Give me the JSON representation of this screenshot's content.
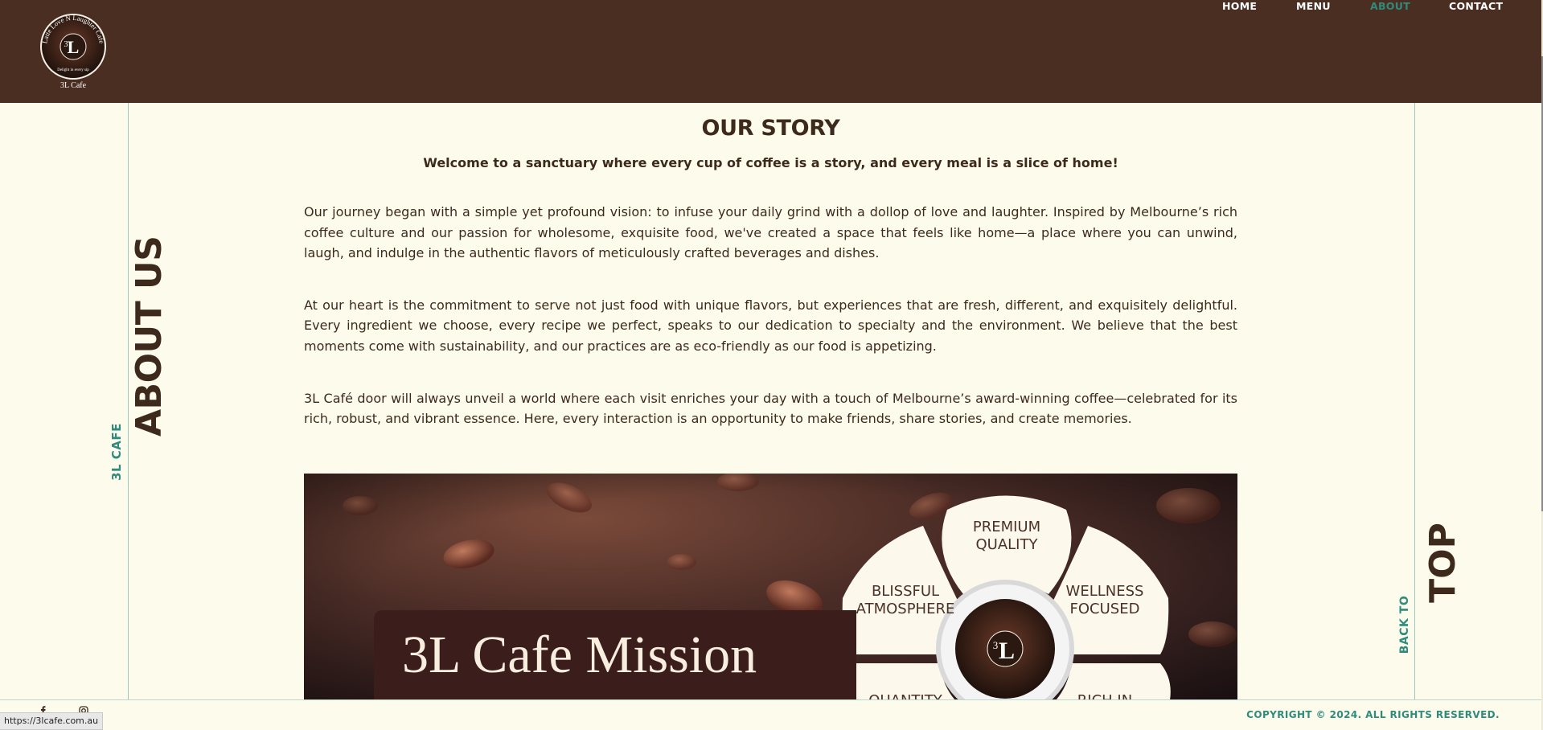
{
  "header": {
    "logo_text": "3L Cafe",
    "logo_ring_text": "Latte Love N Laughter Cafe",
    "logo_tagline": "Delight in every sip",
    "nav": [
      {
        "label": "HOME"
      },
      {
        "label": "MENU"
      },
      {
        "label": "ABOUT",
        "active": true
      },
      {
        "label": "CONTACT"
      }
    ]
  },
  "side": {
    "section_label": "ABOUT US",
    "brand_label": "3L CAFE",
    "back_top": "TOP",
    "back_to": "BACK TO"
  },
  "main": {
    "title": "OUR STORY",
    "welcome": "Welcome to a sanctuary where every cup of coffee is a story, and every meal is a slice of home!",
    "paragraphs": [
      "Our journey began with a simple yet profound vision: to infuse your daily grind with a dollop of love and laughter. Inspired by Melbourne’s rich coffee culture and our passion for wholesome, exquisite food, we've created a space that feels like home—a place where you can unwind, laugh, and indulge in the authentic flavors of meticulously crafted beverages and dishes.",
      "At our heart is the commitment to serve not just food with unique flavors, but experiences that are fresh, different, and exquisitely delightful. Every ingredient we choose, every recipe we perfect, speaks to our dedication to specialty and the environment. We believe that the best moments come with sustainability, and our practices are as eco-friendly as our food is appetizing.",
      "3L Café door will always unveil a world where each visit enriches your day with a touch of Melbourne’s award-winning coffee—celebrated for its rich, robust, and vibrant essence. Here, every interaction is an opportunity to make friends, share stories, and create memories."
    ],
    "mission": {
      "title": "3L Cafe Mission",
      "petals": [
        "PREMIUM\nQUALITY",
        "BLISSFUL\nATMOSPHERE",
        "WELLNESS\nFOCUSED",
        "QUANTITY",
        "RICH IN"
      ]
    }
  },
  "footer": {
    "copyright": "COPYRIGHT © 2024. ALL RIGHTS RESERVED."
  },
  "status_bar": {
    "url": "https://3lcafe.com.au"
  },
  "colors": {
    "header_bg": "#4b2e22",
    "page_bg": "#fdfcec",
    "accent": "#2f8b7c",
    "text": "#3d2a1c"
  }
}
